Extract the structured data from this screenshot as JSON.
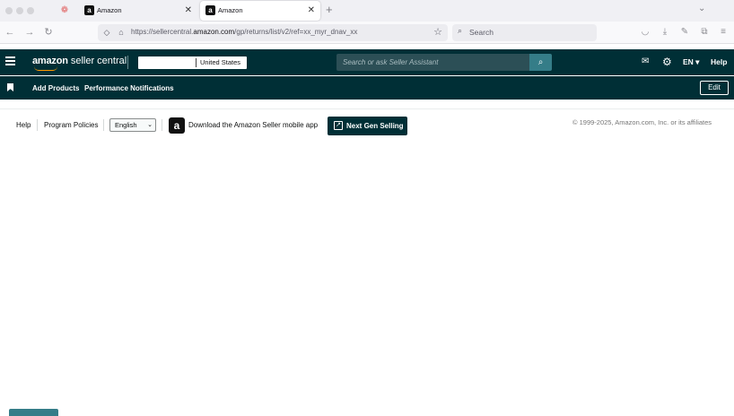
{
  "browser": {
    "tabs": [
      {
        "title": "Amazon",
        "active": false
      },
      {
        "title": "Amazon",
        "active": true
      }
    ],
    "url_prefix": "https://sellercentral.",
    "url_domain": "amazon.com",
    "url_path": "/gp/returns/list/v2/ref=xx_myr_dnav_xx",
    "search_placeholder": "Search"
  },
  "header": {
    "logo_brand": "amazon",
    "logo_product": "seller central",
    "account_country": "United States",
    "assistant_placeholder": "Search or ask Seller Assistant",
    "language": "EN",
    "help": "Help"
  },
  "subnav": {
    "links": [
      "Add Products",
      "Performance Notifications"
    ],
    "edit_label": "Edit"
  },
  "footer": {
    "help": "Help",
    "program_policies": "Program Policies",
    "language_selected": "English",
    "app_download": "Download the Amazon Seller mobile app",
    "next_gen_selling": "Next Gen Selling",
    "copyright": "© 1999-2025, Amazon.com, Inc. or its affiliates"
  },
  "colors": {
    "header_bg": "#002f36",
    "search_button": "#357d88",
    "smile": "#ff9900"
  }
}
